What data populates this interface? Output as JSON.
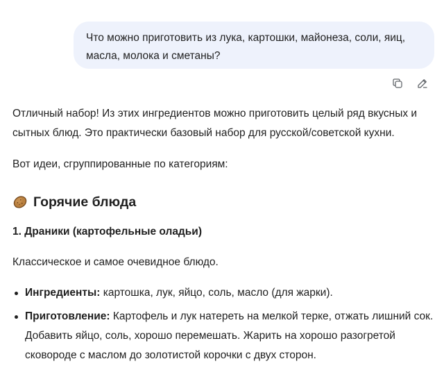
{
  "user_message": {
    "text": "Что можно приготовить из лука, картошки, майонеза, соли, яиц, масла, молока и сметаны?"
  },
  "message_actions": {
    "copy_icon": "copy-icon",
    "edit_icon": "edit-icon"
  },
  "answer": {
    "intro": "Отличный набор! Из этих ингредиентов можно приготовить целый ряд вкусных и сытных блюд. Это практически базовый набор для русской/советской кухни.",
    "ideas": "Вот идеи, сгруппированные по категориям:",
    "section": {
      "emoji": "potato-icon",
      "title": "Горячие блюда"
    },
    "dish": {
      "title": "1. Драники (картофельные оладьи)",
      "description": "Классическое и самое очевидное блюдо.",
      "details": [
        {
          "label": "Ингредиенты:",
          "text": " картошка, лук, яйцо, соль, масло (для жарки)."
        },
        {
          "label": "Приготовление:",
          "text": " Картофель и лук натереть на мелкой терке, отжать лишний сок. Добавить яйцо, соль, хорошо перемешать. Жарить на хорошо разогретой сковороде с маслом до золотистой корочки с двух сторон."
        }
      ]
    }
  },
  "colors": {
    "bubble_bg": "#eef2fc",
    "text": "#1f1f1f",
    "icon": "#5f6368"
  }
}
